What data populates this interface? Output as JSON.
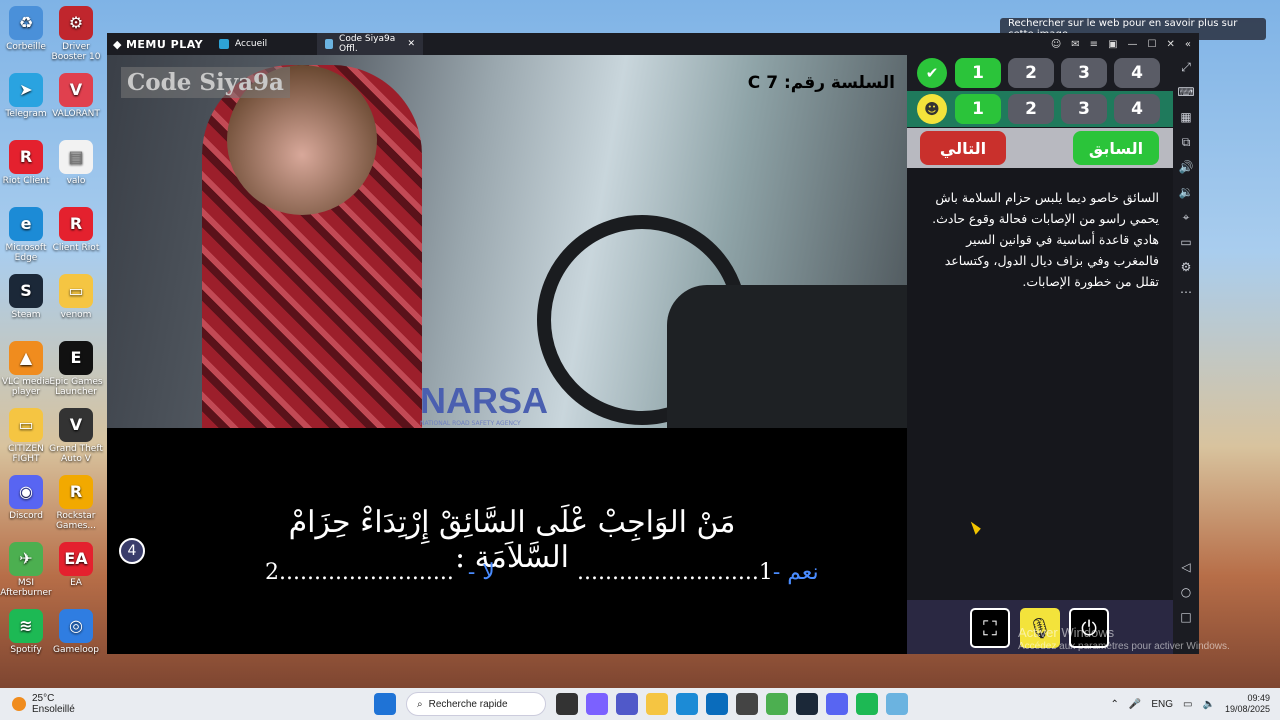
{
  "desktop": {
    "icons": [
      {
        "label": "Corbeille",
        "color": "#4a90d9",
        "glyph": "♻"
      },
      {
        "label": "Driver Booster 10",
        "color": "#c0262d",
        "glyph": "⚙"
      },
      {
        "label": "Telegram",
        "color": "#2aa3e0",
        "glyph": "➤"
      },
      {
        "label": "VALORANT",
        "color": "#e0404e",
        "glyph": "V"
      },
      {
        "label": "Riot Client",
        "color": "#e4212e",
        "glyph": "R"
      },
      {
        "label": "valo",
        "color": "#f2f2f2",
        "glyph": "▤"
      },
      {
        "label": "Microsoft Edge",
        "color": "#1c8bd6",
        "glyph": "e"
      },
      {
        "label": "Client Riot",
        "color": "#e4212e",
        "glyph": "R"
      },
      {
        "label": "Steam",
        "color": "#1b2838",
        "glyph": "S"
      },
      {
        "label": "venom",
        "color": "#f5c542",
        "glyph": "▭"
      },
      {
        "label": "VLC media player",
        "color": "#f08c1e",
        "glyph": "▲"
      },
      {
        "label": "Epic Games Launcher",
        "color": "#111111",
        "glyph": "E"
      },
      {
        "label": "CITIZEN FIGHT",
        "color": "#f5c542",
        "glyph": "▭"
      },
      {
        "label": "Grand Theft Auto V",
        "color": "#333333",
        "glyph": "V"
      },
      {
        "label": "Discord",
        "color": "#5865f2",
        "glyph": "◉"
      },
      {
        "label": "Rockstar Games...",
        "color": "#f2a900",
        "glyph": "R"
      },
      {
        "label": "MSI Afterburner",
        "color": "#4caf50",
        "glyph": "✈"
      },
      {
        "label": "EA",
        "color": "#e4212e",
        "glyph": "EA"
      },
      {
        "label": "Spotify",
        "color": "#1db954",
        "glyph": "≋"
      },
      {
        "label": "Gameloop",
        "color": "#2f7de1",
        "glyph": "◎"
      }
    ],
    "search_hint": "Rechercher sur le web pour en savoir plus sur cette image",
    "activate_line1": "Activer Windows",
    "activate_line2": "Accédez aux paramètres pour activer Windows."
  },
  "emulator": {
    "logo": "MEMU PLAY",
    "tabs": [
      {
        "label": "Accueil"
      },
      {
        "label": "Code Siya9a Offl."
      }
    ]
  },
  "quiz": {
    "watermark": "Code Siya9a",
    "series_label": "السلسة رقم: 7 C",
    "narsa_logo": "NARSA",
    "narsa_sub": "NATIONAL ROAD SAFETY AGENCY",
    "question": "مَنْ الوَاجِبْ عْلَى السَّائِقْ إِرْتِدَاءْ حِزَامْ السَّلاَمَة :",
    "answer_yes_word": "- نعم",
    "answer_yes_dots": "..........................1",
    "answer_no_word": "- لا",
    "answer_no_dots": "2.........................",
    "question_number": "4"
  },
  "panel": {
    "answer_row": {
      "numbers": [
        "1",
        "2",
        "3",
        "4"
      ],
      "selected": "1"
    },
    "user_row": {
      "numbers": [
        "1",
        "2",
        "3",
        "4"
      ],
      "selected": "1"
    },
    "next_label": "التالي",
    "prev_label": "السابق",
    "explanation": "السائق خاصو ديما يلبس حزام السلامة باش يحمي راسو من الإصابات فحالة وقوع حادث. هادي قاعدة أساسية في قوانين السير فالمغرب وفي بزاف ديال الدول، وكتساعد تقلل من خطورة الإصابات."
  },
  "taskbar": {
    "temperature": "25°C",
    "weather": "Ensoleillé",
    "search_placeholder": "Recherche rapide",
    "language": "ENG",
    "time": "09:49",
    "date": "19/08/2025"
  }
}
